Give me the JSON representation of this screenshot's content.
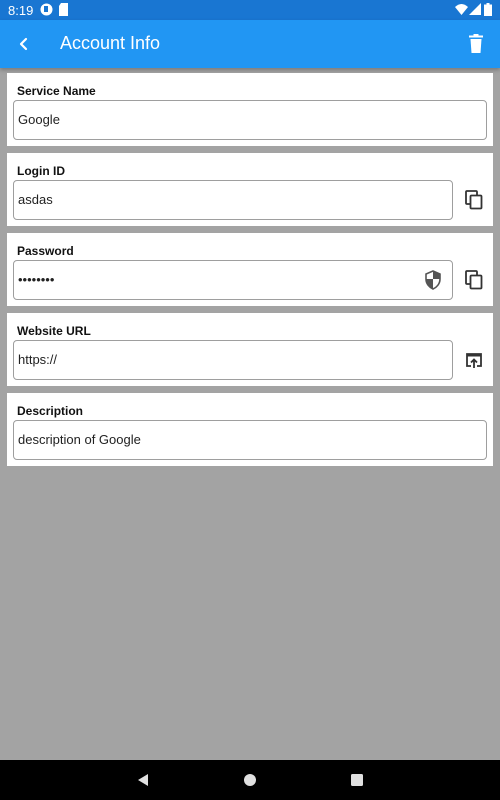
{
  "status_bar": {
    "time": "8:19",
    "icons": [
      "notification-icon",
      "sd-card-icon",
      "wifi-icon",
      "signal-icon",
      "battery-icon"
    ]
  },
  "app_bar": {
    "title": "Account Info",
    "color": "#2196f3",
    "back_icon": "chevron-left-icon",
    "delete_icon": "trash-icon"
  },
  "fields": {
    "service_name": {
      "label": "Service Name",
      "value": "Google"
    },
    "login_id": {
      "label": "Login ID",
      "value": "asdas",
      "action_icon": "copy-icon"
    },
    "password": {
      "label": "Password",
      "value": "••••••••",
      "visibility_icon": "shield-icon",
      "action_icon": "copy-icon"
    },
    "website_url": {
      "label": "Website URL",
      "value": "https://",
      "action_icon": "open-in-browser-icon"
    },
    "description": {
      "label": "Description",
      "value": "description of Google"
    }
  },
  "nav_bar": {
    "icons": [
      "back-triangle-icon",
      "home-circle-icon",
      "recents-square-icon"
    ]
  }
}
